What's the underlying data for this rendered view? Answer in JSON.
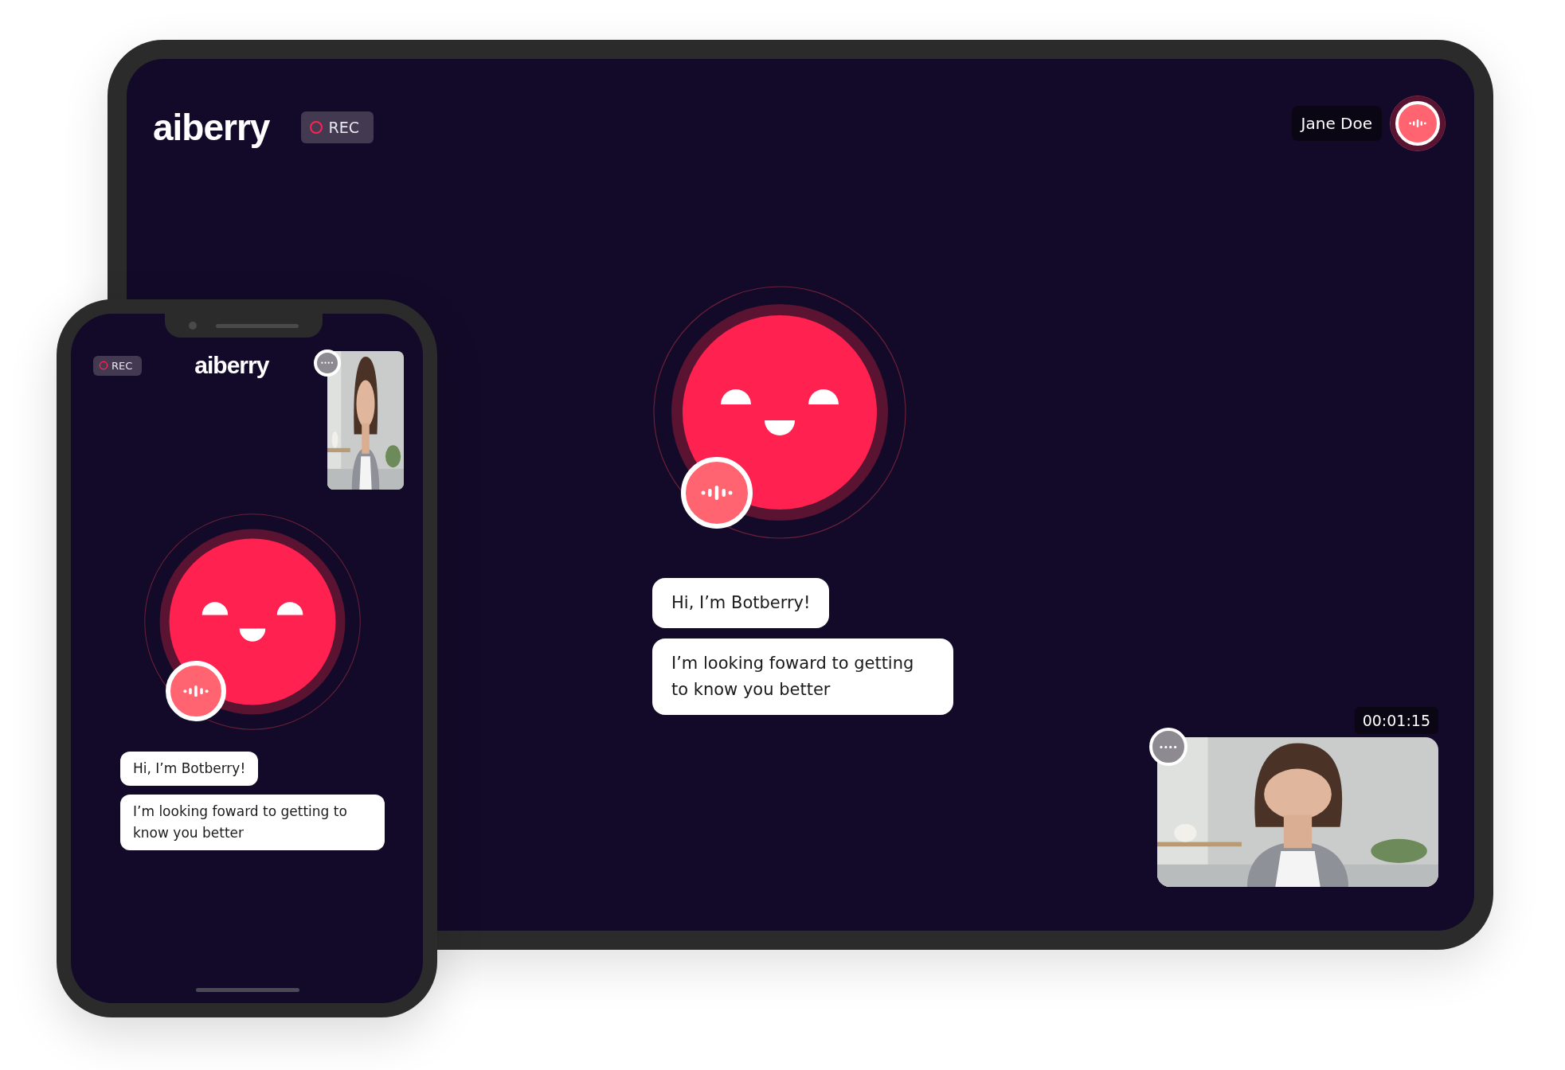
{
  "tablet": {
    "rec_label": "REC",
    "logo": "aiberry",
    "user_name": "Jane Doe",
    "bot_messages": [
      "Hi, I’m Botberry!",
      "I’m looking foward to getting to know you better"
    ],
    "call_timer": "00:01:15"
  },
  "phone": {
    "rec_label": "REC",
    "logo": "aiberry",
    "bot_messages": [
      "Hi, I’m Botberry!",
      "I’m looking foward to getting to know you better"
    ]
  }
}
